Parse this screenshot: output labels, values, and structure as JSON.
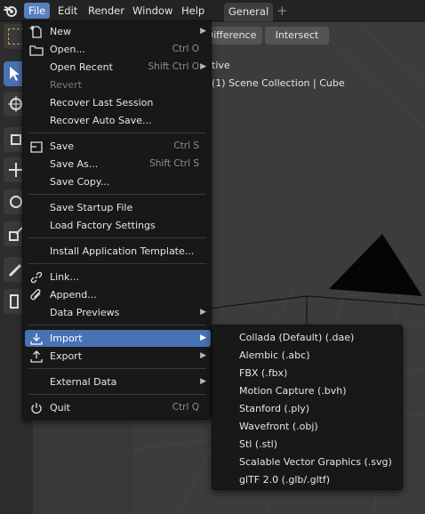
{
  "header": {
    "menus": [
      "File",
      "Edit",
      "Render",
      "Window",
      "Help"
    ],
    "workspace_tab": "General",
    "add_tab": "+"
  },
  "viewport": {
    "mode_buttons": [
      "Difference",
      "Intersect"
    ],
    "mode_partial": "...",
    "perspective_text": "tive",
    "collection_text": "(1) Scene Collection | Cube"
  },
  "file_menu": {
    "items": [
      {
        "label": "New",
        "shortcut": "",
        "submenu": true,
        "icon": "new-file-icon"
      },
      {
        "label": "Open...",
        "shortcut": "Ctrl O",
        "submenu": false,
        "icon": "folder-icon"
      },
      {
        "label": "Open Recent",
        "shortcut": "Shift Ctrl O",
        "submenu": true,
        "icon": ""
      },
      {
        "label": "Revert",
        "shortcut": "",
        "submenu": false,
        "icon": "",
        "disabled": true
      },
      {
        "label": "Recover Last Session",
        "shortcut": "",
        "submenu": false,
        "icon": ""
      },
      {
        "label": "Recover Auto Save...",
        "shortcut": "",
        "submenu": false,
        "icon": ""
      },
      {
        "label": "Save",
        "shortcut": "Ctrl S",
        "submenu": false,
        "icon": "save-icon"
      },
      {
        "label": "Save As...",
        "shortcut": "Shift Ctrl S",
        "submenu": false,
        "icon": ""
      },
      {
        "label": "Save Copy...",
        "shortcut": "",
        "submenu": false,
        "icon": ""
      },
      {
        "label": "Save Startup File",
        "shortcut": "",
        "submenu": false,
        "icon": ""
      },
      {
        "label": "Load Factory Settings",
        "shortcut": "",
        "submenu": false,
        "icon": ""
      },
      {
        "label": "Install Application Template...",
        "shortcut": "",
        "submenu": false,
        "icon": ""
      },
      {
        "label": "Link...",
        "shortcut": "",
        "submenu": false,
        "icon": "link-icon"
      },
      {
        "label": "Append...",
        "shortcut": "",
        "submenu": false,
        "icon": "append-icon"
      },
      {
        "label": "Data Previews",
        "shortcut": "",
        "submenu": true,
        "icon": ""
      },
      {
        "label": "Import",
        "shortcut": "",
        "submenu": true,
        "icon": "import-icon",
        "highlighted": true
      },
      {
        "label": "Export",
        "shortcut": "",
        "submenu": true,
        "icon": "export-icon"
      },
      {
        "label": "External Data",
        "shortcut": "",
        "submenu": true,
        "icon": ""
      },
      {
        "label": "Quit",
        "shortcut": "Ctrl Q",
        "submenu": false,
        "icon": "power-icon"
      }
    ]
  },
  "import_menu": {
    "items": [
      "Collada (Default) (.dae)",
      "Alembic (.abc)",
      "FBX (.fbx)",
      "Motion Capture (.bvh)",
      "Stanford (.ply)",
      "Wavefront (.obj)",
      "Stl (.stl)",
      "Scalable Vector Graphics (.svg)",
      "glTF 2.0 (.glb/.gltf)"
    ]
  },
  "colors": {
    "accent": "#4772b3",
    "menu_bg": "#181818",
    "viewport_bg": "#393939"
  }
}
